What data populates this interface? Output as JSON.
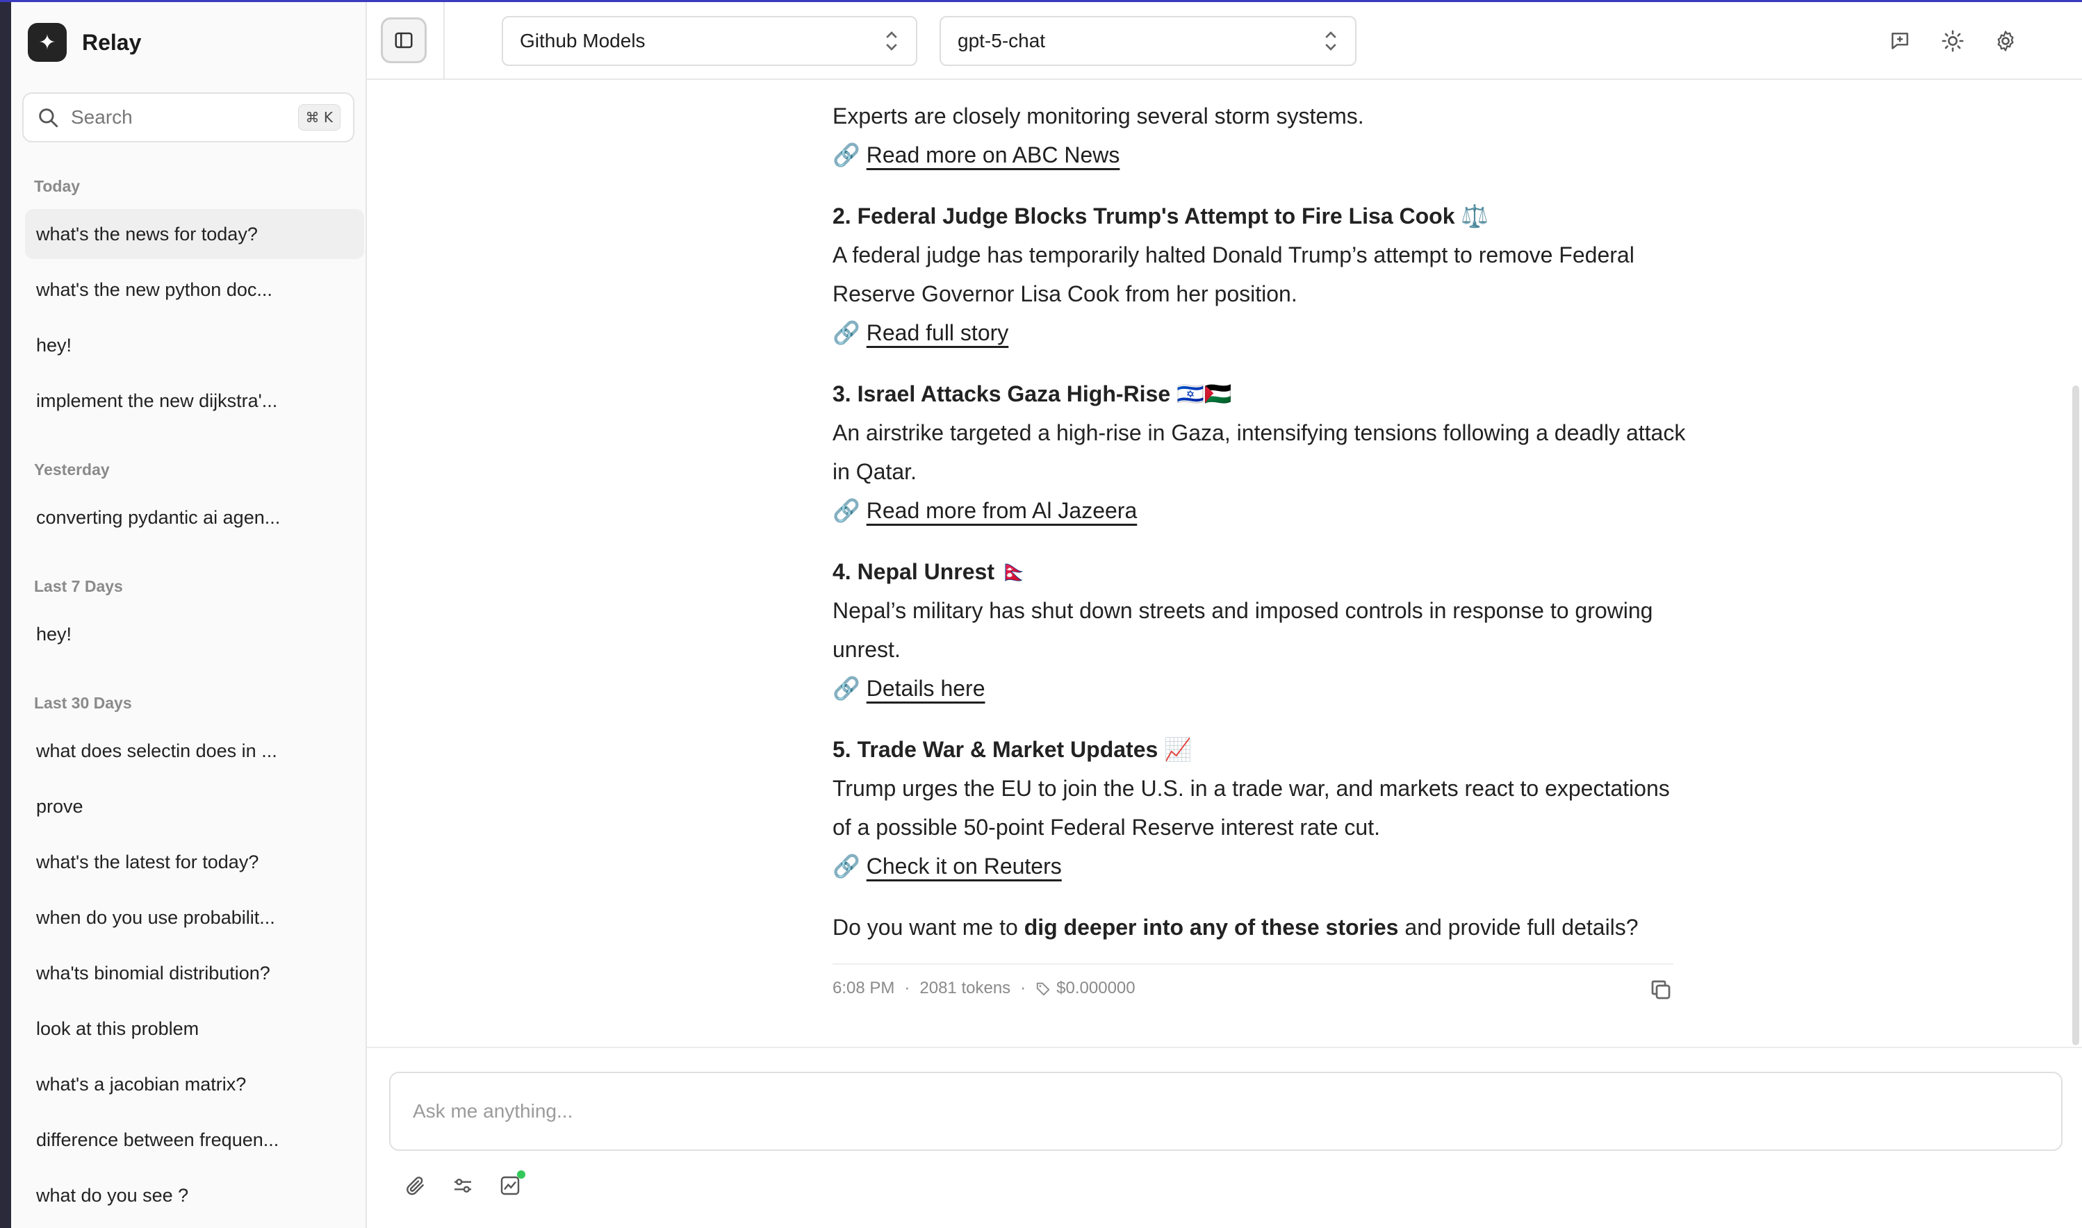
{
  "app": {
    "name": "Relay"
  },
  "search": {
    "placeholder": "Search",
    "shortcut": "⌘ K"
  },
  "sidebar": {
    "groups": [
      {
        "label": "Today",
        "items": [
          "what's the news for today?",
          "what's the new python doc...",
          "hey!",
          "implement the new dijkstra'..."
        ]
      },
      {
        "label": "Yesterday",
        "items": [
          "converting pydantic ai agen..."
        ]
      },
      {
        "label": "Last 7 Days",
        "items": [
          "hey!"
        ]
      },
      {
        "label": "Last 30 Days",
        "items": [
          "what does selectin does in ...",
          "prove",
          "what's the latest for today?",
          "when do you use probabilit...",
          "wha'ts binomial distribution?",
          "look at this problem",
          "what's a jacobian matrix?",
          "difference between frequen...",
          "what do you see ?"
        ]
      }
    ],
    "active_item": "what's the news for today?"
  },
  "topbar": {
    "provider": "Github Models",
    "model": "gpt-5-chat",
    "icons": [
      "new-chat-icon",
      "theme-sun-icon",
      "settings-gear-icon"
    ]
  },
  "message": {
    "intro_line": "Experts are closely monitoring several storm systems.",
    "intro_link": "Read more on ABC News",
    "stories": [
      {
        "title": "2. Federal Judge Blocks Trump's Attempt to Fire Lisa Cook ⚖️",
        "body": "A federal judge has temporarily halted Donald Trump’s attempt to remove Federal Reserve Governor Lisa Cook from her position.",
        "link": "Read full story"
      },
      {
        "title": "3. Israel Attacks Gaza High-Rise 🇮🇱🇵🇸",
        "body": "An airstrike targeted a high-rise in Gaza, intensifying tensions following a deadly attack in Qatar.",
        "link": "Read more from Al Jazeera"
      },
      {
        "title": "4. Nepal Unrest 🇳🇵",
        "body": "Nepal’s military has shut down streets and imposed controls in response to growing unrest.",
        "link": "Details here"
      },
      {
        "title": "5. Trade War & Market Updates 📈",
        "body": "Trump urges the EU to join the U.S. in a trade war, and markets react to expectations of a possible 50-point Federal Reserve interest rate cut.",
        "link": "Check it on Reuters"
      }
    ],
    "closing_prefix": "Do you want me to ",
    "closing_bold": "dig deeper into any of these stories",
    "closing_suffix": " and provide full details?",
    "link_glyph": "🔗",
    "meta": {
      "time": "6:08 PM",
      "tokens": "2081 tokens",
      "cost": "$0.000000"
    }
  },
  "composer": {
    "placeholder": "Ask me anything..."
  },
  "colors": {
    "accent": "#3b3bbf",
    "status_green": "#34c759"
  }
}
